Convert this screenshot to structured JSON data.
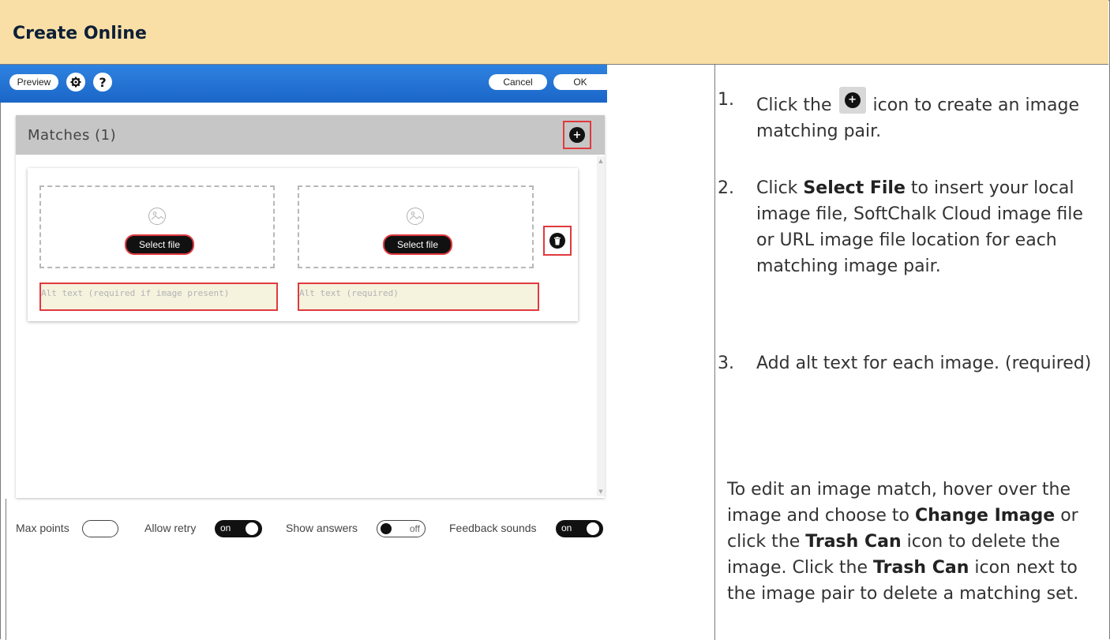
{
  "header": {
    "title": "Create Online"
  },
  "toolbar": {
    "preview_label": "Preview",
    "settings_icon": "gear-icon",
    "help_label": "?",
    "cancel_label": "Cancel",
    "ok_label": "OK"
  },
  "editor": {
    "matches_title": "Matches (1)",
    "add_icon": "+",
    "left_item": {
      "select_label": "Select file",
      "alt_placeholder": "Alt text (required if image present)"
    },
    "right_item": {
      "select_label": "Select file",
      "alt_placeholder": "Alt text (required)"
    }
  },
  "settings": {
    "max_points_label": "Max points",
    "allow_retry_label": "Allow retry",
    "allow_retry_state": "on",
    "show_answers_label": "Show answers",
    "show_answers_state": "off",
    "feedback_sounds_label": "Feedback sounds",
    "feedback_sounds_state": "on"
  },
  "instructions": {
    "step1_num": "1.",
    "step1_pre": "Click the",
    "step1_post": "icon to create an image matching pair.",
    "step2_num": "2.",
    "step2_pre": "Click",
    "step2_bold": "Select File",
    "step2_post": "to insert your local image file, SoftChalk Cloud image file or URL image file location for each matching image pair.",
    "step3_num": "3.",
    "step3_text": "Add alt text for each image. (required)",
    "note_p1": "To edit an image match, hover over the image and choose to",
    "note_b1": "Change Image",
    "note_p2": "or click the",
    "note_b2": "Trash Can",
    "note_p3": "icon to delete the image. Click the",
    "note_b3": "Trash Can",
    "note_p4": "icon next to the image pair to delete a matching set."
  },
  "colors": {
    "header_bg": "#f9dfa6",
    "toolbar_blue": "#1a66c8",
    "highlight_red": "#e0393e",
    "alt_bg": "#f5f2de"
  }
}
